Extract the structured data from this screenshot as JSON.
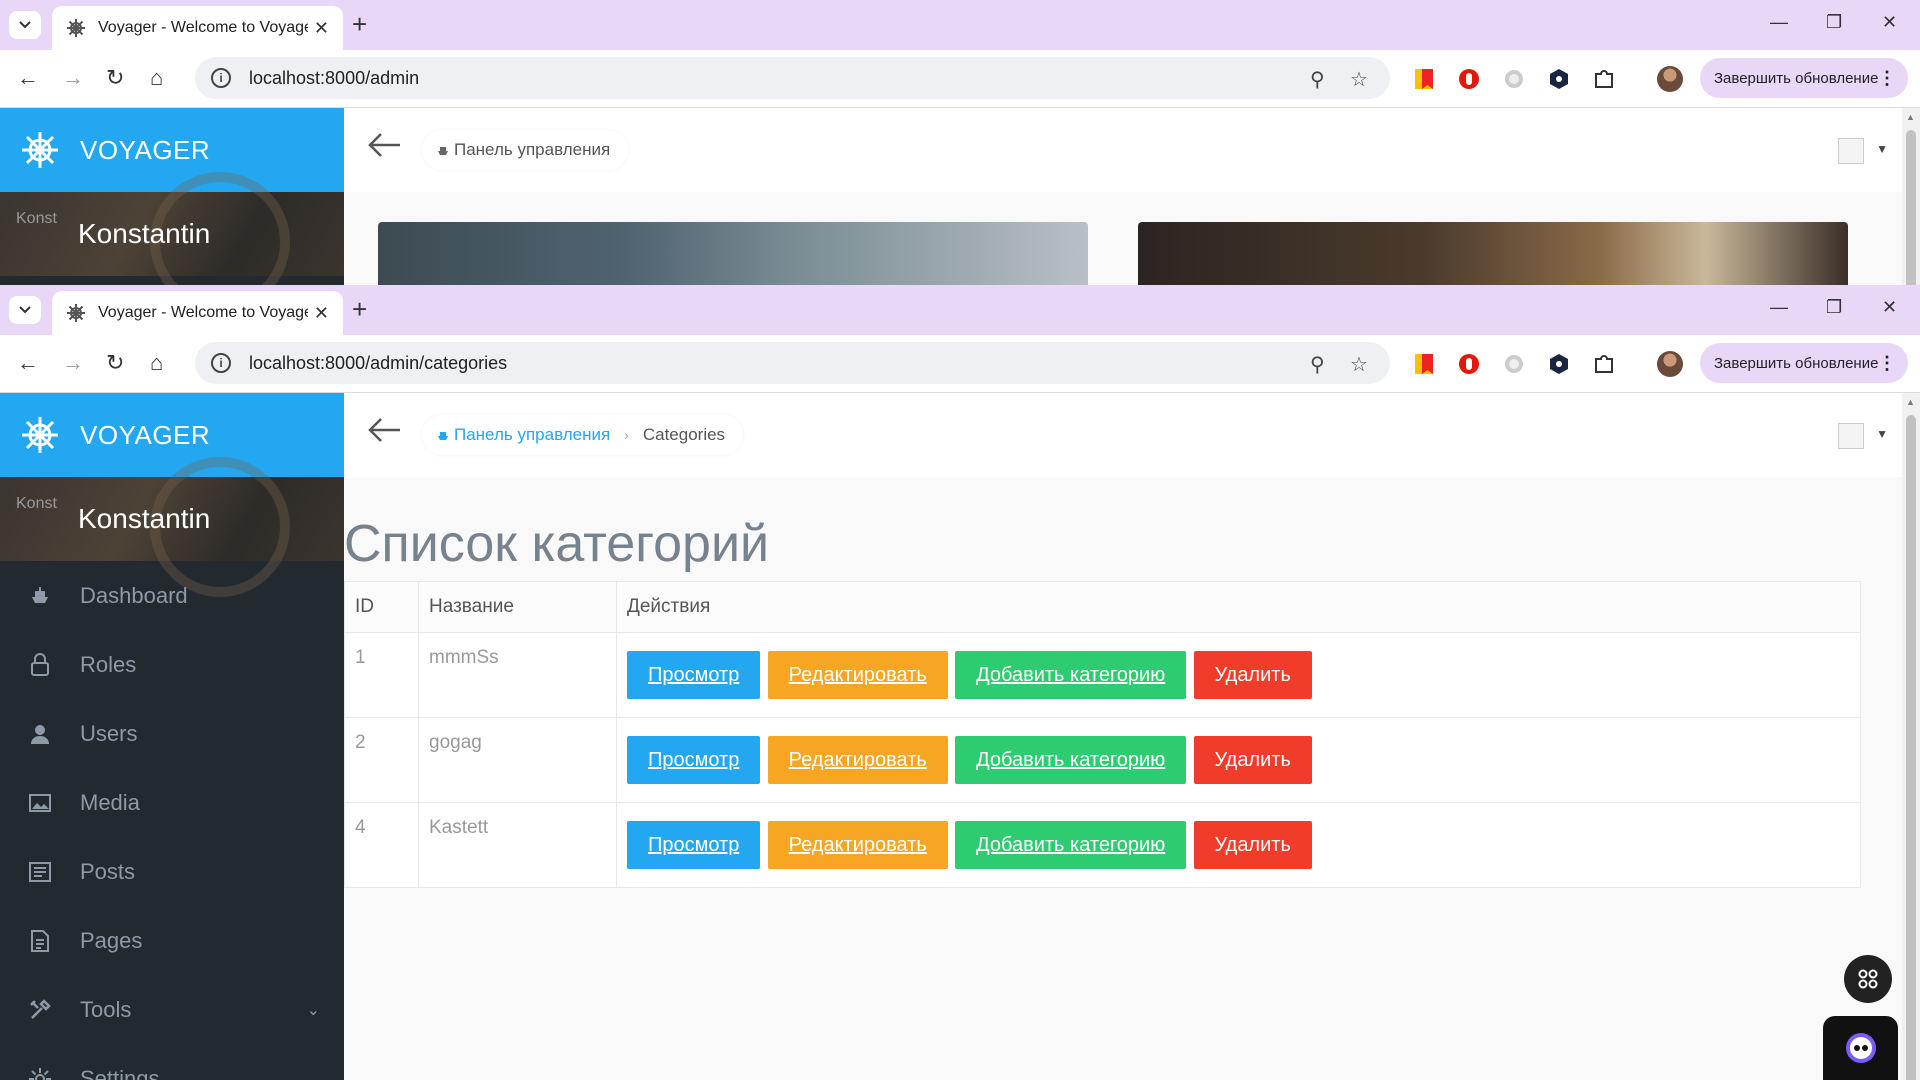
{
  "window1": {
    "tab_title": "Voyager - Welcome to Voyager",
    "url": "localhost:8000/admin",
    "update_label": "Завершить обновление",
    "brand": "VOYAGER",
    "profile_img_alt": "Konst",
    "profile_name": "Konstantin",
    "breadcrumb_home": "Панель управления"
  },
  "window2": {
    "tab_title": "Voyager - Welcome to Voyager",
    "url": "localhost:8000/admin/categories",
    "update_label": "Завершить обновление",
    "brand": "VOYAGER",
    "profile_img_alt": "Konst",
    "profile_name": "Konstantin",
    "breadcrumb_home": "Панель управления",
    "breadcrumb_current": "Categories",
    "page_title": "Список категорий",
    "menu": {
      "dashboard": "Dashboard",
      "roles": "Roles",
      "users": "Users",
      "media": "Media",
      "posts": "Posts",
      "pages": "Pages",
      "tools": "Tools",
      "settings": "Settings"
    },
    "table": {
      "headers": [
        "ID",
        "Название",
        "Действия"
      ],
      "rows": [
        {
          "id": "1",
          "name": "mmmSs"
        },
        {
          "id": "2",
          "name": "gogag"
        },
        {
          "id": "4",
          "name": "Kastett"
        }
      ],
      "actions": {
        "view": "Просмотр",
        "edit": "Редактировать",
        "add": "Добавить категорию",
        "delete": "Удалить"
      }
    }
  },
  "colors": {
    "brand_blue": "#22a7f0",
    "edit_orange": "#f6a623",
    "add_green": "#2ecc71",
    "delete_red": "#f23c2a",
    "sidebar_dark": "#22292f",
    "chrome_frame": "#e9d7f7"
  },
  "icons": [
    "settings-helm-icon",
    "back-arrow-icon",
    "dashboard-boat-icon",
    "lock-icon",
    "user-icon",
    "media-image-icon",
    "posts-icon",
    "pages-icon",
    "tools-icon",
    "gear-icon",
    "zoom-icon",
    "star-icon"
  ]
}
